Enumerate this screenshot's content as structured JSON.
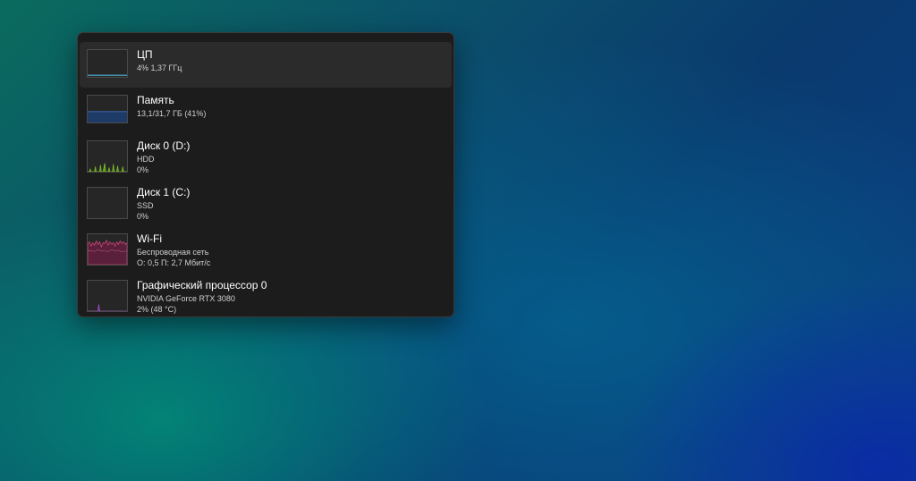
{
  "items": [
    {
      "name": "ЦП",
      "line1": "4%  1,37 ГГц",
      "line2": ""
    },
    {
      "name": "Память",
      "line1": "13,1/31,7 ГБ (41%)",
      "line2": ""
    },
    {
      "name": "Диск 0 (D:)",
      "line1": "HDD",
      "line2": "0%"
    },
    {
      "name": "Диск 1 (C:)",
      "line1": "SSD",
      "line2": "0%"
    },
    {
      "name": "Wi-Fi",
      "line1": "Беспроводная сеть",
      "line2": "О: 0,5  П: 2,7 Мбит/с"
    },
    {
      "name": "Графический процессор 0",
      "line1": "NVIDIA GeForce RTX 3080",
      "line2": "2%  (48 °C)"
    }
  ],
  "colors": {
    "cpu": "#4fb7d8",
    "memory": "#2f5a9e",
    "disk0": "#7cbd2a",
    "wifi": "#d0477d",
    "gpu": "#a24fd0"
  }
}
